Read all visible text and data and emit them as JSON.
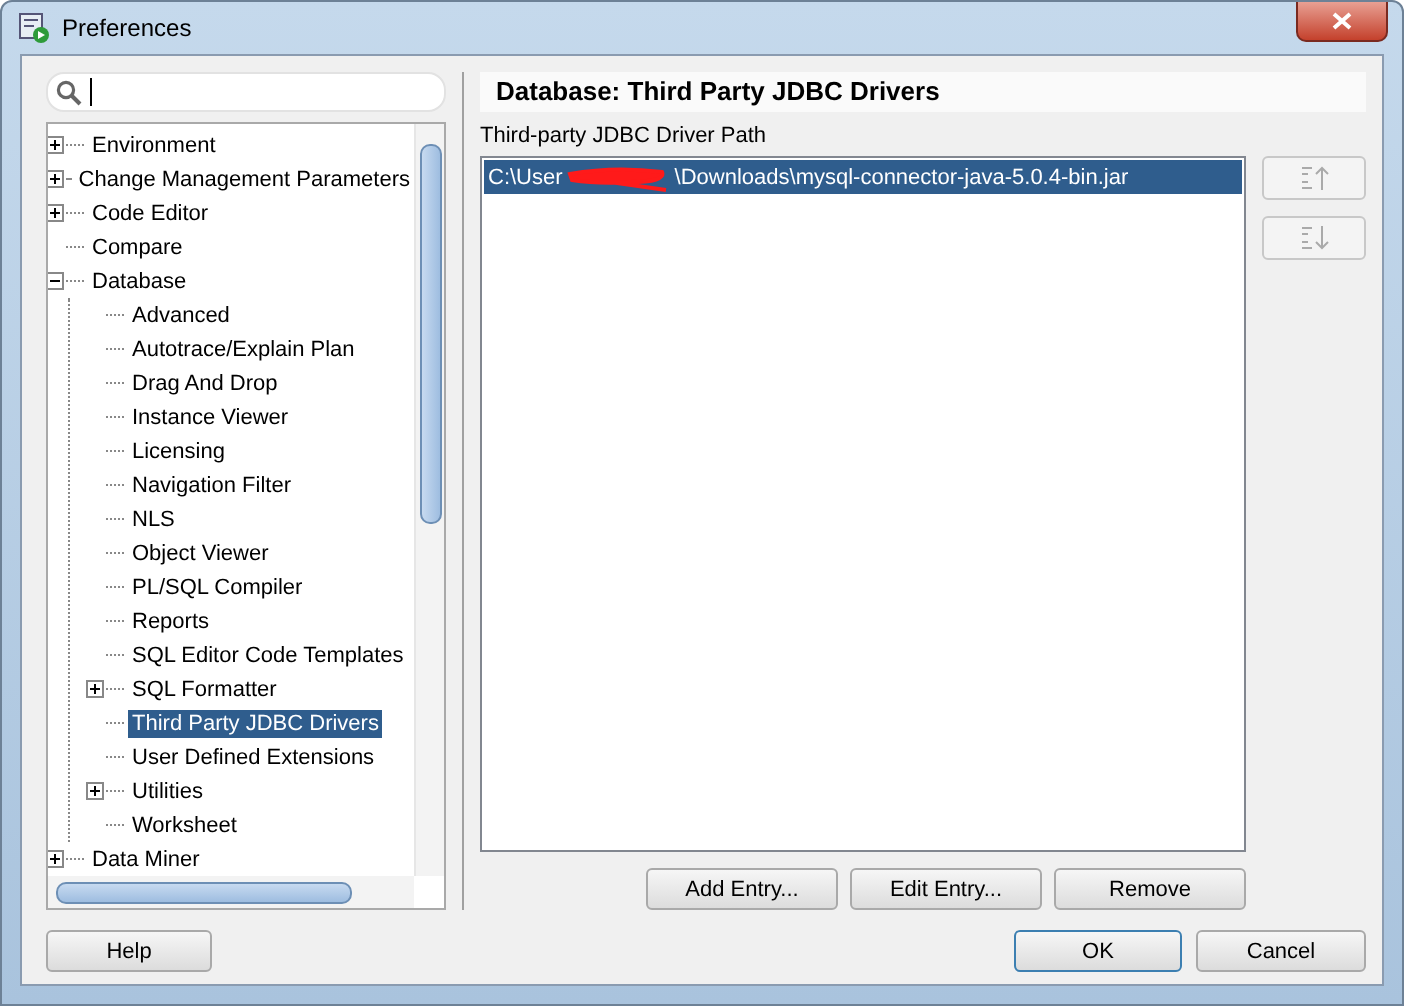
{
  "window": {
    "title": "Preferences"
  },
  "tree": [
    {
      "label": "Environment",
      "kind": "folder",
      "expanded": false,
      "selected": false
    },
    {
      "label": "Change Management Parameters",
      "kind": "folder",
      "expanded": false,
      "selected": false
    },
    {
      "label": "Code Editor",
      "kind": "folder",
      "expanded": false,
      "selected": false
    },
    {
      "label": "Compare",
      "kind": "leaf",
      "selected": false
    },
    {
      "label": "Database",
      "kind": "folder",
      "expanded": true,
      "selected": false,
      "children": [
        {
          "label": "Advanced",
          "kind": "leaf",
          "selected": false
        },
        {
          "label": "Autotrace/Explain Plan",
          "kind": "leaf",
          "selected": false
        },
        {
          "label": "Drag And Drop",
          "kind": "leaf",
          "selected": false
        },
        {
          "label": "Instance Viewer",
          "kind": "leaf",
          "selected": false
        },
        {
          "label": "Licensing",
          "kind": "leaf",
          "selected": false
        },
        {
          "label": "Navigation Filter",
          "kind": "leaf",
          "selected": false
        },
        {
          "label": "NLS",
          "kind": "leaf",
          "selected": false
        },
        {
          "label": "Object Viewer",
          "kind": "leaf",
          "selected": false
        },
        {
          "label": "PL/SQL Compiler",
          "kind": "leaf",
          "selected": false
        },
        {
          "label": "Reports",
          "kind": "leaf",
          "selected": false
        },
        {
          "label": "SQL Editor Code Templates",
          "kind": "leaf",
          "selected": false
        },
        {
          "label": "SQL Formatter",
          "kind": "folder",
          "expanded": false,
          "selected": false
        },
        {
          "label": "Third Party JDBC Drivers",
          "kind": "leaf",
          "selected": true
        },
        {
          "label": "User Defined Extensions",
          "kind": "leaf",
          "selected": false
        },
        {
          "label": "Utilities",
          "kind": "folder",
          "expanded": false,
          "selected": false
        },
        {
          "label": "Worksheet",
          "kind": "leaf",
          "selected": false
        }
      ]
    },
    {
      "label": "Data Miner",
      "kind": "folder",
      "expanded": false,
      "selected": false
    }
  ],
  "page": {
    "heading": "Database: Third Party JDBC Drivers",
    "list_label": "Third-party JDBC Driver Path",
    "entries": [
      {
        "path_start": "C:\\User",
        "path_end": "\\Downloads\\mysql-connector-java-5.0.4-bin.jar",
        "selected": true
      }
    ],
    "actions": [
      "Add Entry...",
      "Edit Entry...",
      "Remove"
    ]
  },
  "footer": {
    "help": "Help",
    "ok": "OK",
    "cancel": "Cancel"
  }
}
